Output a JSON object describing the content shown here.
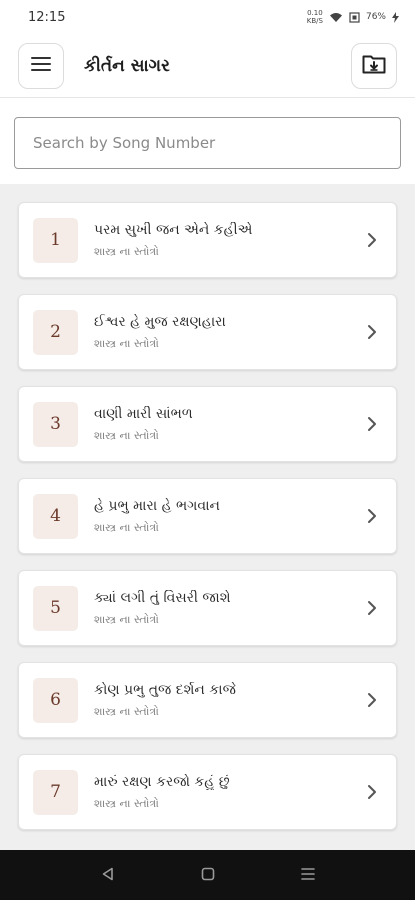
{
  "status_bar": {
    "time": "12:15",
    "net_speed_value": "0.10",
    "net_speed_unit": "KB/S",
    "battery": "76%"
  },
  "app_bar": {
    "title": "કીર્તન સાગર",
    "menu_icon": "hamburger-menu-icon",
    "action_icon": "folder-download-icon"
  },
  "search": {
    "placeholder": "Search by Song Number",
    "value": ""
  },
  "songs": [
    {
      "number": "1",
      "title": "પરમ સુખી જન એને કહીએ",
      "category": "શાસ્ત્ર ના સ્તોત્રો"
    },
    {
      "number": "2",
      "title": "ઈશ્વર હે મુજ રક્ષણહારા",
      "category": "શાસ્ત્ર ના સ્તોત્રો"
    },
    {
      "number": "3",
      "title": "વાણી મારી સાંભળ",
      "category": "શાસ્ત્ર ના સ્તોત્રો"
    },
    {
      "number": "4",
      "title": "હે પ્રભુ મારા હે ભગવાન",
      "category": "શાસ્ત્ર ના સ્તોત્રો"
    },
    {
      "number": "5",
      "title": "ક્યાં લગી તું વિસરી જાશે",
      "category": "શાસ્ત્ર ના સ્તોત્રો"
    },
    {
      "number": "6",
      "title": "કોણ પ્રભુ તુજ દર્શન કાજે",
      "category": "શાસ્ત્ર ના સ્તોત્રો"
    },
    {
      "number": "7",
      "title": "મારું રક્ષણ કરજો કહું છું",
      "category": "શાસ્ત્ર ના સ્તોત્રો"
    }
  ],
  "colors": {
    "number_badge_bg": "#f5ece8",
    "number_text": "#6b3a2a",
    "nav_bar": "#111111"
  }
}
